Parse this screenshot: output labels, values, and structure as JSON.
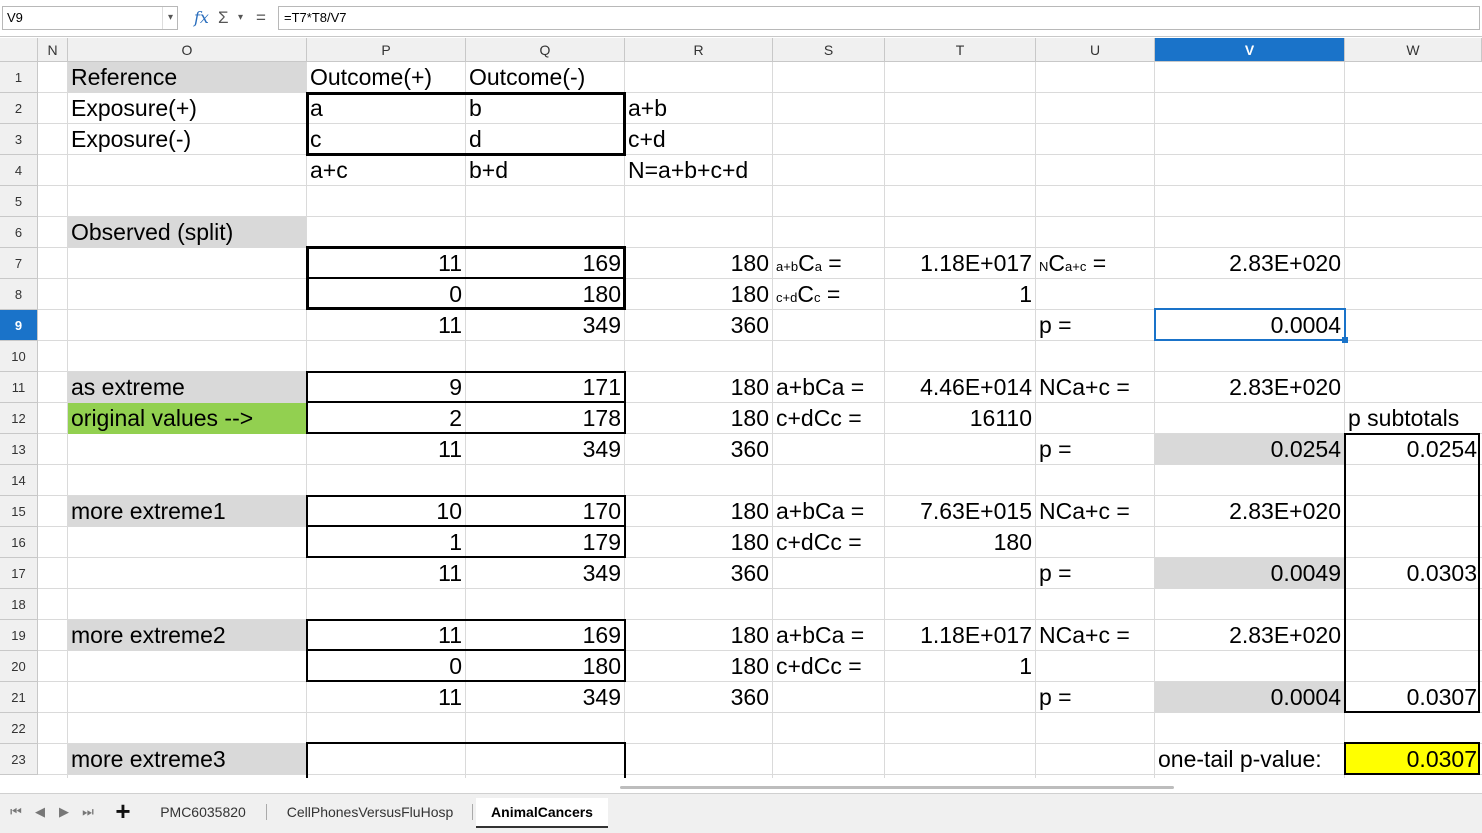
{
  "formula_bar": {
    "cell_ref": "V9",
    "fx": "fx",
    "sigma": "Σ",
    "equals": "=",
    "formula": "=T7*T8/V7"
  },
  "columns": [
    "N",
    "O",
    "P",
    "Q",
    "R",
    "S",
    "T",
    "U",
    "V",
    "W"
  ],
  "selected_column": "V",
  "rows": [
    "1",
    "2",
    "3",
    "4",
    "5",
    "6",
    "7",
    "8",
    "9",
    "10",
    "11",
    "12",
    "13",
    "14",
    "15",
    "16",
    "17",
    "18",
    "19",
    "20",
    "21",
    "22",
    "23"
  ],
  "selected_row": "9",
  "cells": {
    "O1": "Reference",
    "P1": "Outcome(+)",
    "Q1": "Outcome(-)",
    "O2": "Exposure(+)",
    "P2": "a",
    "Q2": "b",
    "R2": "a+b",
    "O3": "Exposure(-)",
    "P3": "c",
    "Q3": "d",
    "R3": "c+d",
    "P4": "a+c",
    "Q4": "b+d",
    "R4": "N=a+b+c+d",
    "O6": "Observed (split)",
    "P7": "11",
    "Q7": "169",
    "R7": "180",
    "S7_pre": "a+b",
    "S7_main": "C",
    "S7_sub": "a",
    "S7_post": " =",
    "T7": "1.18E+017",
    "U7_pre": "N",
    "U7_main": "C",
    "U7_sub": "a+c",
    "U7_post": " =",
    "V7": "2.83E+020",
    "P8": "0",
    "Q8": "180",
    "R8": "180",
    "S8_pre": "c+d",
    "S8_main": "C",
    "S8_sub": "c",
    "S8_post": " =",
    "T8": "1",
    "P9": "11",
    "Q9": "349",
    "R9": "360",
    "U9": "p =",
    "V9": "0.0004",
    "O11": "as extreme",
    "P11": "9",
    "Q11": "171",
    "R11": "180",
    "S11": "a+bCa =",
    "T11": "4.46E+014",
    "U11": "NCa+c =",
    "V11": "2.83E+020",
    "O12": "original values -->",
    "P12": "2",
    "Q12": "178",
    "R12": "180",
    "S12": "c+dCc =",
    "T12": "16110",
    "W12": "p subtotals",
    "P13": "11",
    "Q13": "349",
    "R13": "360",
    "U13": "p =",
    "V13": "0.0254",
    "W13": "0.0254",
    "O15": "more extreme1",
    "P15": "10",
    "Q15": "170",
    "R15": "180",
    "S15": "a+bCa =",
    "T15": "7.63E+015",
    "U15": "NCa+c =",
    "V15": "2.83E+020",
    "P16": "1",
    "Q16": "179",
    "R16": "180",
    "S16": "c+dCc =",
    "T16": "180",
    "P17": "11",
    "Q17": "349",
    "R17": "360",
    "U17": "p =",
    "V17": "0.0049",
    "W17": "0.0303",
    "O19": "more extreme2",
    "P19": "11",
    "Q19": "169",
    "R19": "180",
    "S19": "a+bCa =",
    "T19": "1.18E+017",
    "U19": "NCa+c =",
    "V19": "2.83E+020",
    "P20": "0",
    "Q20": "180",
    "R20": "180",
    "S20": "c+dCc =",
    "T20": "1",
    "P21": "11",
    "Q21": "349",
    "R21": "360",
    "U21": "p =",
    "V21": "0.0004",
    "W21": "0.0307",
    "O23": "more extreme3",
    "V23": "one-tail p-value:",
    "W23": "0.0307"
  },
  "sheet_tabs": [
    "PMC6035820",
    "CellPhonesVersusFluHosp",
    "AnimalCancers"
  ],
  "active_tab": "AnimalCancers",
  "nav": {
    "first": "⏮",
    "prev": "◀",
    "next": "▶",
    "last": "⏭",
    "add": "+"
  },
  "colors": {
    "selection": "#1a73c9",
    "label_gray": "#d9d9d9",
    "highlight_green": "#92d050",
    "highlight_yellow": "#ffff00"
  }
}
